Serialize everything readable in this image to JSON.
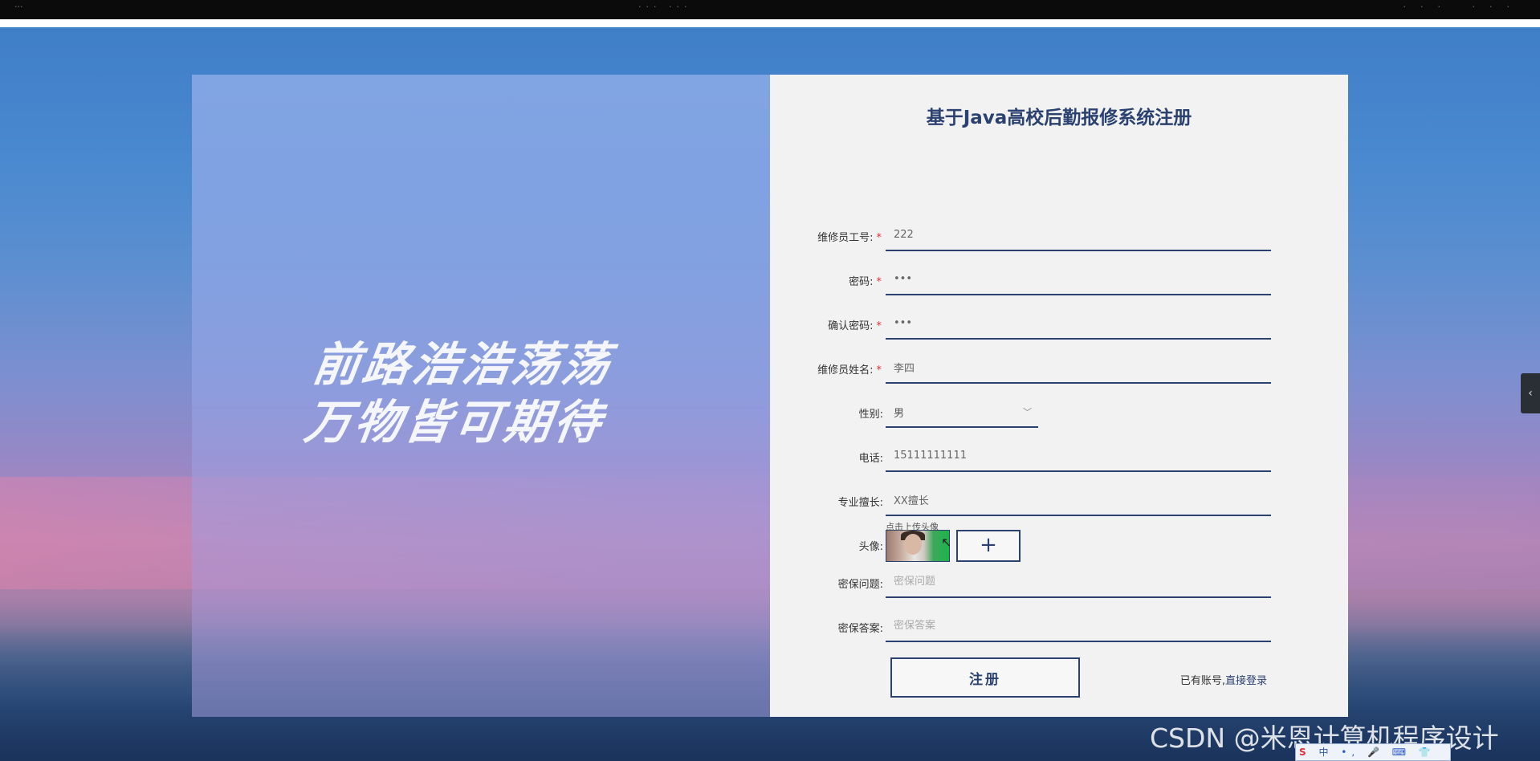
{
  "topbar": {
    "left_text": "···",
    "center_text": "··· ···",
    "right_text": "··· ···"
  },
  "slogan": {
    "line1": "前路浩浩荡荡",
    "line2": "万物皆可期待"
  },
  "form": {
    "title": "基于Java高校后勤报修系统注册",
    "fields": {
      "worker_id": {
        "label": "维修员工号:",
        "value": "222"
      },
      "password": {
        "label": "密码:",
        "value": "•••"
      },
      "confirm_password": {
        "label": "确认密码:",
        "value": "•••"
      },
      "worker_name": {
        "label": "维修员姓名:",
        "value": "李四"
      },
      "gender": {
        "label": "性别:",
        "value": "男"
      },
      "phone": {
        "label": "电话:",
        "value": "15111111111"
      },
      "specialty": {
        "label": "专业擅长:",
        "value": "XX擅长"
      },
      "avatar": {
        "label": "头像:",
        "upload_symbol": "+",
        "hint": "点击上传头像"
      },
      "security_question": {
        "label": "密保问题:",
        "placeholder": "密保问题"
      },
      "security_answer": {
        "label": "密保答案:",
        "placeholder": "密保答案"
      }
    },
    "required_mark": "*",
    "register_label": "注册",
    "login_prompt": "已有账号,",
    "login_link": "直接登录"
  },
  "side_tab": {
    "symbol": "‹"
  },
  "watermark": "CSDN @米恩计算机程序设计",
  "ime": {
    "logo": "S",
    "text": "中 •, 🎤 ⌨ 👕 🎮 ▦ ✲"
  },
  "colors": {
    "accent": "#2b4170",
    "required": "#e0303a",
    "panel_bg": "#f2f2f2"
  }
}
